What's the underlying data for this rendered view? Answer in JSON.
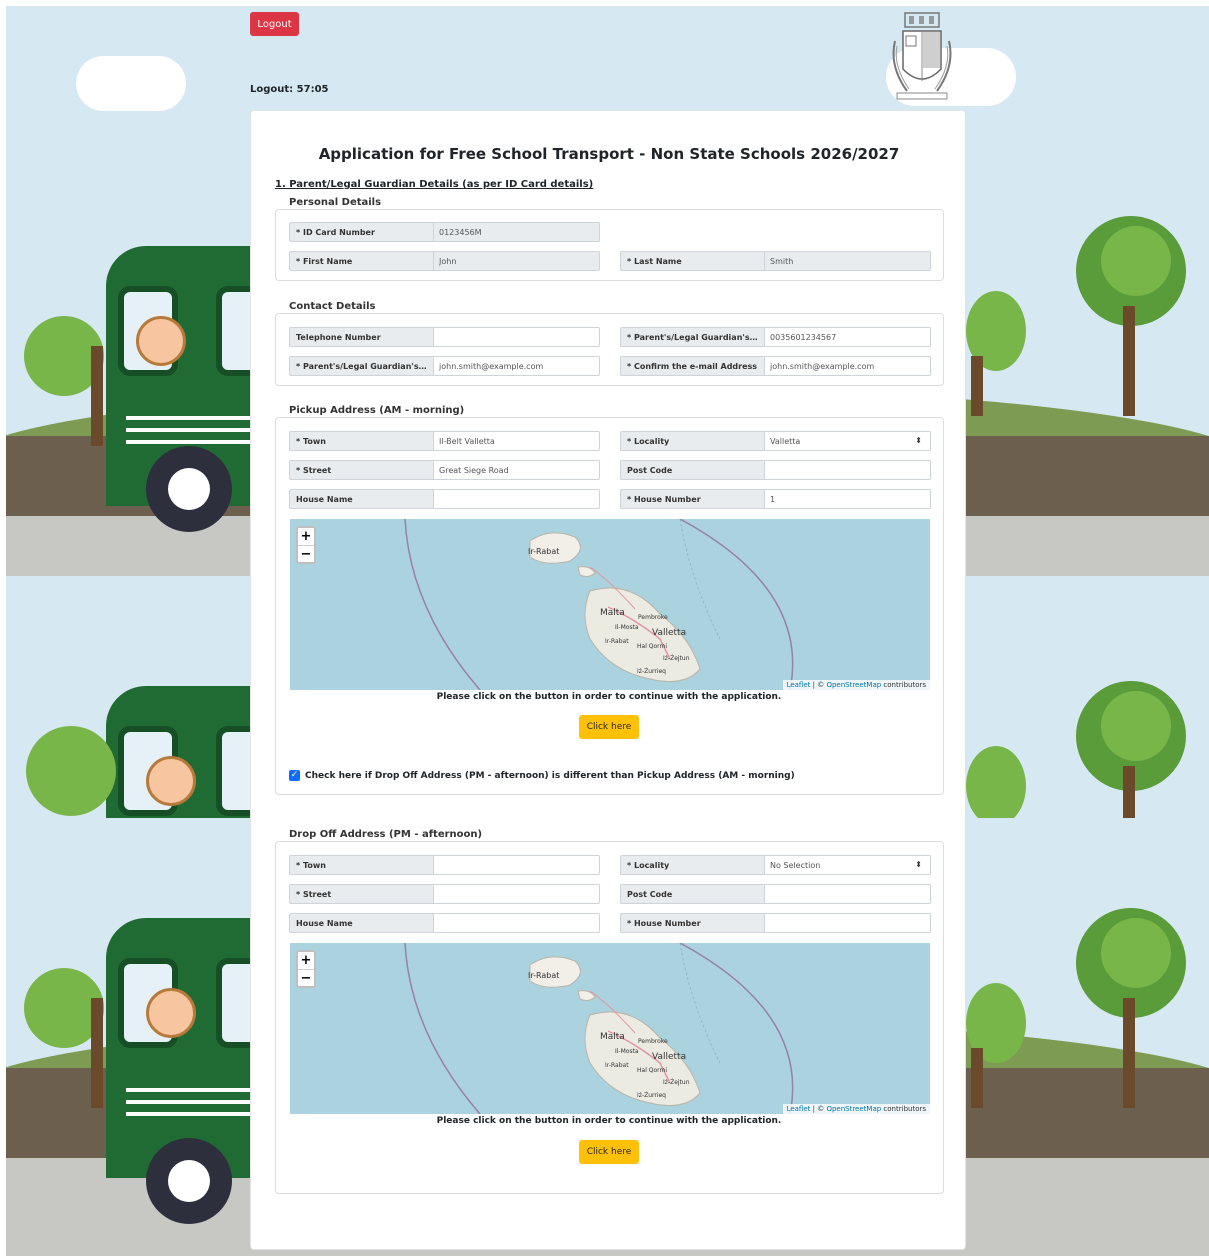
{
  "header": {
    "logout_button": "Logout",
    "timer": "Logout: 57:05"
  },
  "form": {
    "title": "Application for Free School Transport - Non State Schools 2026/2027",
    "section1_title": "1. Parent/Legal Guardian Details (as per ID Card details)",
    "personal": {
      "legend": "Personal Details",
      "id_label": "* ID Card Number",
      "id_value": "0123456M",
      "first_name_label": "* First Name",
      "first_name_value": "John",
      "last_name_label": "* Last Name",
      "last_name_value": "Smith"
    },
    "contact": {
      "legend": "Contact Details",
      "telephone_label": "Telephone Number",
      "telephone_value": "",
      "mobile_label": "* Parent's/Legal Guardian's M...",
      "mobile_value": "0035601234567",
      "email_label": "* Parent's/Legal Guardian's e-...",
      "email_value": "john.smith@example.com",
      "confirm_email_label": "* Confirm the e-mail Address",
      "confirm_email_value": "john.smith@example.com"
    },
    "pickup": {
      "legend": "Pickup Address (AM - morning)",
      "town_label": "* Town",
      "town_value": "Il-Belt Valletta",
      "locality_label": "* Locality",
      "locality_value": "Valletta",
      "street_label": "* Street",
      "street_value": "Great Siege Road",
      "postcode_label": "Post Code",
      "postcode_value": "",
      "house_name_label": "House Name",
      "house_name_value": "",
      "house_number_label": "* House Number",
      "house_number_value": "1",
      "note": "Please click on the button in order to continue with the application.",
      "button": "Click here"
    },
    "dropoff_check": {
      "checked": true,
      "label": "Check here if Drop Off Address (PM - afternoon) is different than Pickup Address (AM - morning)"
    },
    "dropoff": {
      "legend": "Drop Off Address (PM - afternoon)",
      "town_label": "* Town",
      "town_value": "",
      "locality_label": "* Locality",
      "locality_value": "No Selection",
      "street_label": "* Street",
      "street_value": "",
      "postcode_label": "Post Code",
      "postcode_value": "",
      "house_name_label": "House Name",
      "house_name_value": "",
      "house_number_label": "* House Number",
      "house_number_value": "",
      "note": "Please click on the button in order to continue with the application.",
      "button": "Click here"
    }
  },
  "map": {
    "zoom_in": "+",
    "zoom_out": "−",
    "labels": {
      "rabat_gozo": "Ir-Rabat",
      "malta": "Malta",
      "pembroke": "Pembroke",
      "mosta": "Il-Mosta",
      "valletta": "Valletta",
      "rabat": "Ir-Rabat",
      "qormi": "Hal Qormi",
      "zejtun": "Iż-Żejtun",
      "zurrieq": "Iż-Żurrieq"
    },
    "attribution_leaflet": "Leaflet",
    "attribution_sep": " | © ",
    "attribution_osm": "OpenStreetMap",
    "attribution_tail": " contributors"
  },
  "colors": {
    "danger": "#dc3545",
    "warning": "#ffc107",
    "primary": "#0d6efd",
    "sky": "#d6e9f2",
    "bus": "#1f6b33"
  }
}
